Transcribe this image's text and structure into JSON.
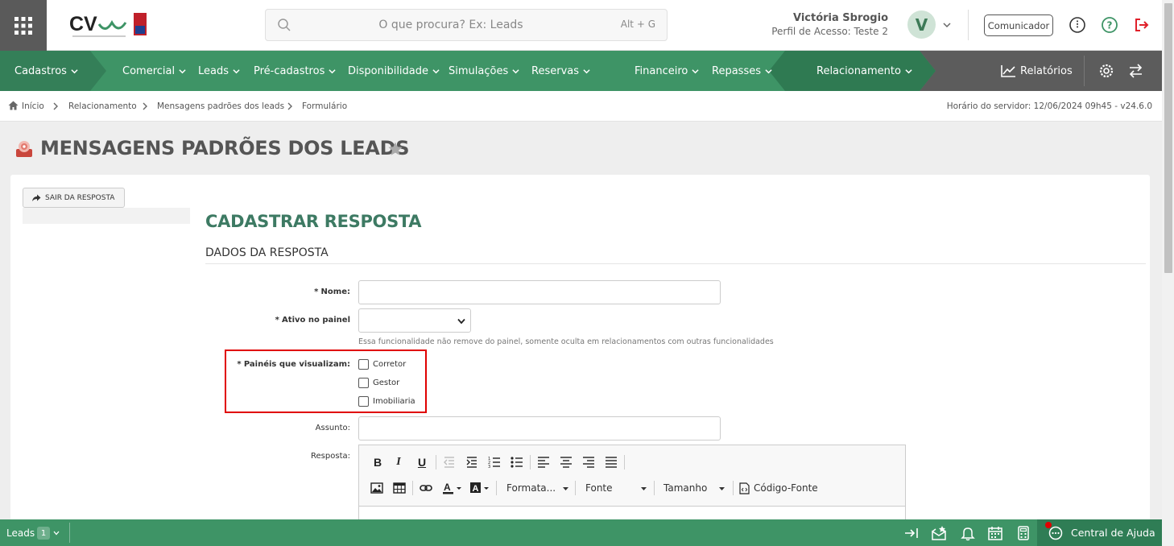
{
  "header": {
    "search_placeholder": "O que procura? Ex: Leads",
    "search_shortcut": "Alt + G",
    "user_name": "Victória Sbrogio",
    "user_profile": "Perfil de Acesso: Teste 2",
    "avatar_initial": "V",
    "communicator_label": "Comunicador"
  },
  "nav": {
    "cadastros": "Cadastros",
    "comercial": "Comercial",
    "leads": "Leads",
    "precadastros": "Pré-cadastros",
    "disponibilidade": "Disponibilidade",
    "simulacoes": "Simulações",
    "reservas": "Reservas",
    "financeiro": "Financeiro",
    "repasses": "Repasses",
    "relacionamento": "Relacionamento",
    "relatorios": "Relatórios"
  },
  "breadcrumb": {
    "items": [
      "Início",
      "Relacionamento",
      "Mensagens padrões dos leads",
      "Formulário"
    ],
    "server_time": "Horário do servidor: 12/06/2024 09h45 - v24.6.0"
  },
  "page": {
    "title": "MENSAGENS PADRÕES DOS LEADS",
    "exit_button": "SAIR DA RESPOSTA",
    "form_title": "CADASTRAR RESPOSTA",
    "section_title": "DADOS DA RESPOSTA"
  },
  "form": {
    "nome_label": "Nome:",
    "ativo_label": "Ativo no painel",
    "ativo_help": "Essa funcionalidade não remove do painel, somente oculta em relacionamentos com outras funcionalidades",
    "paineis_label": "Painéis que visualizam:",
    "paineis_options": [
      "Corretor",
      "Gestor",
      "Imobiliaria"
    ],
    "assunto_label": "Assunto:",
    "resposta_label": "Resposta:",
    "required_mark": "*"
  },
  "editor": {
    "format_label": "Formata...",
    "font_label": "Fonte",
    "size_label": "Tamanho",
    "source_label": "Código-Fonte"
  },
  "bottom": {
    "leads_label": "Leads",
    "leads_count": "1",
    "help_center": "Central de Ajuda"
  },
  "colors": {
    "nav_green": "#3e9466",
    "nav_dark": "#2f7a52",
    "title_green": "#3d7a63",
    "highlight_red": "#e00000"
  }
}
